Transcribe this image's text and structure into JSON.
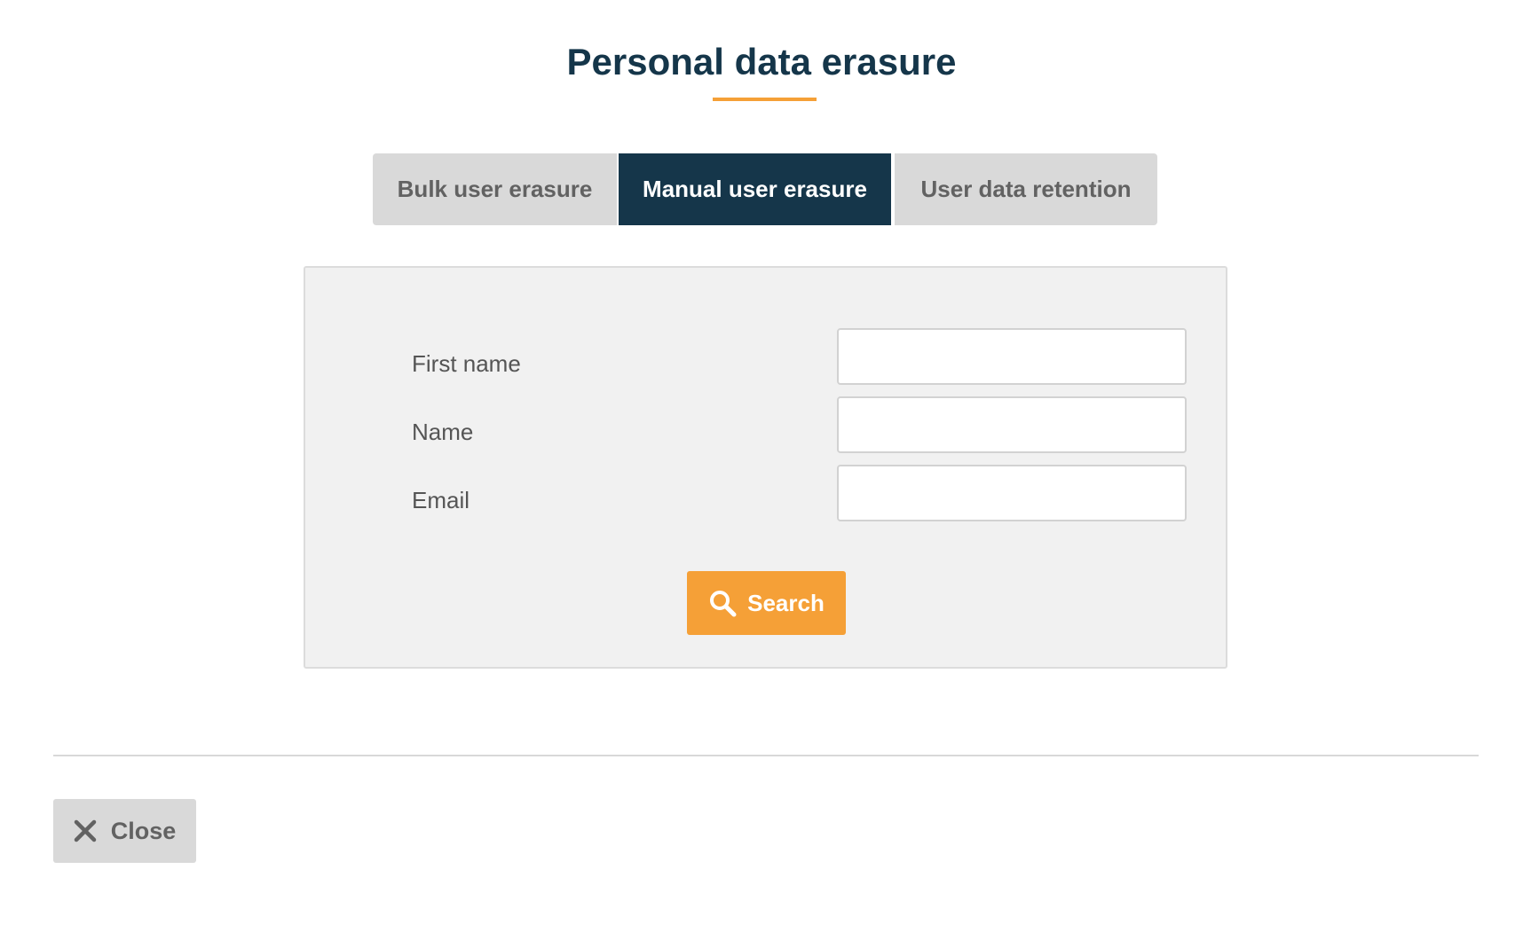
{
  "dialog": {
    "title": "Personal data erasure"
  },
  "tabs": [
    {
      "label": "Bulk user erasure",
      "active": false
    },
    {
      "label": "Manual user erasure",
      "active": true
    },
    {
      "label": "User data retention",
      "active": false
    }
  ],
  "form": {
    "fields": [
      {
        "label": "First name",
        "value": "",
        "placeholder": ""
      },
      {
        "label": "Name",
        "value": "",
        "placeholder": ""
      },
      {
        "label": "Email",
        "value": "",
        "placeholder": ""
      }
    ],
    "search_label": "Search",
    "search_icon": "search-icon"
  },
  "footer": {
    "close_label": "Close",
    "close_icon": "close-icon"
  },
  "colors": {
    "primary_dark": "#15364a",
    "accent_orange": "#f5a037",
    "tab_inactive": "#d9d9d9",
    "panel_bg": "#f1f1f1"
  }
}
